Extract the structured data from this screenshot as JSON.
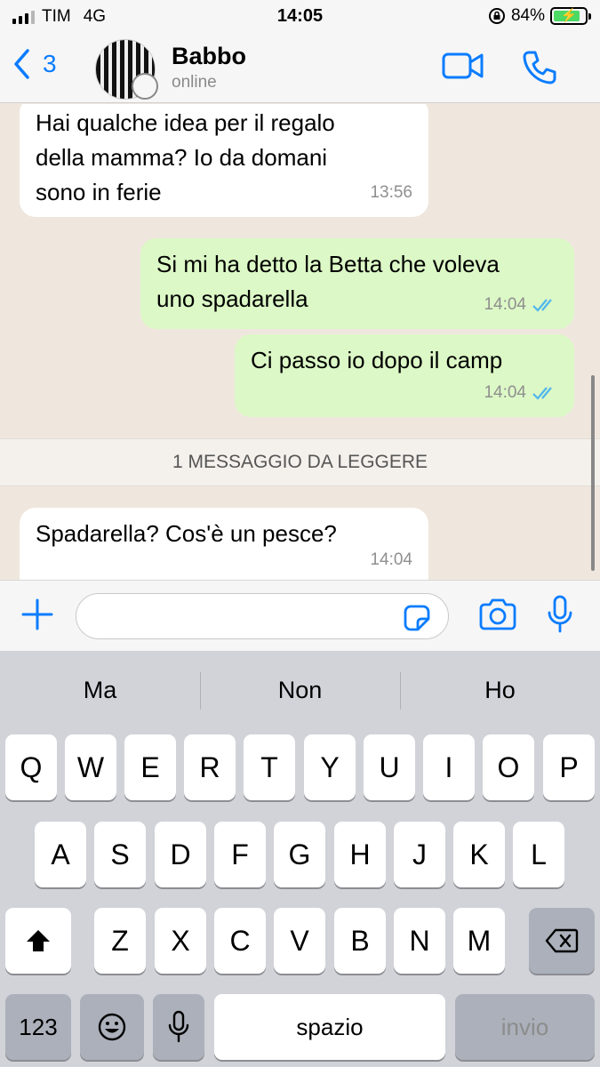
{
  "status_bar": {
    "carrier": "TIM",
    "network": "4G",
    "time": "14:05",
    "battery": "84%",
    "battery_level": 0.84
  },
  "header": {
    "back_count": "3",
    "contact_name": "Babbo",
    "contact_status": "online"
  },
  "messages": [
    {
      "direction": "in",
      "lines": [
        "Hai qualche idea per il regalo",
        "della mamma? Io da domani",
        "sono in ferie"
      ],
      "time": "13:56"
    },
    {
      "direction": "out",
      "lines": [
        "Si mi ha detto la Betta che voleva",
        "uno spadarella"
      ],
      "time": "14:04",
      "read": true
    },
    {
      "direction": "out",
      "lines": [
        "Ci passo io dopo il camp"
      ],
      "time": "14:04",
      "read": true
    },
    {
      "direction": "in",
      "lines": [
        "Spadarella? Cos'è un pesce?"
      ],
      "time": "14:04"
    }
  ],
  "unread_banner": "1 MESSAGGIO DA LEGGERE",
  "input": {
    "value": "",
    "placeholder": ""
  },
  "keyboard": {
    "suggestions": [
      "Ma",
      "Non",
      "Ho"
    ],
    "row1": [
      "Q",
      "W",
      "E",
      "R",
      "T",
      "Y",
      "U",
      "I",
      "O",
      "P"
    ],
    "row2": [
      "A",
      "S",
      "D",
      "F",
      "G",
      "H",
      "J",
      "K",
      "L"
    ],
    "row3": [
      "Z",
      "X",
      "C",
      "V",
      "B",
      "N",
      "M"
    ],
    "numbers_key": "123",
    "space_key": "spazio",
    "return_key": "invio"
  },
  "colors": {
    "accent": "#0a7cff",
    "outgoing_bubble": "#dcf8c6",
    "incoming_bubble": "#ffffff",
    "read_ticks": "#4fb6ec"
  },
  "icons": [
    "signal-icon",
    "lock-rotation-icon",
    "battery-icon",
    "back-chevron-icon",
    "video-call-icon",
    "phone-icon",
    "read-ticks-icon",
    "plus-icon",
    "sticker-icon",
    "camera-icon",
    "microphone-icon",
    "shift-icon",
    "delete-icon",
    "emoji-icon",
    "dictation-icon"
  ]
}
